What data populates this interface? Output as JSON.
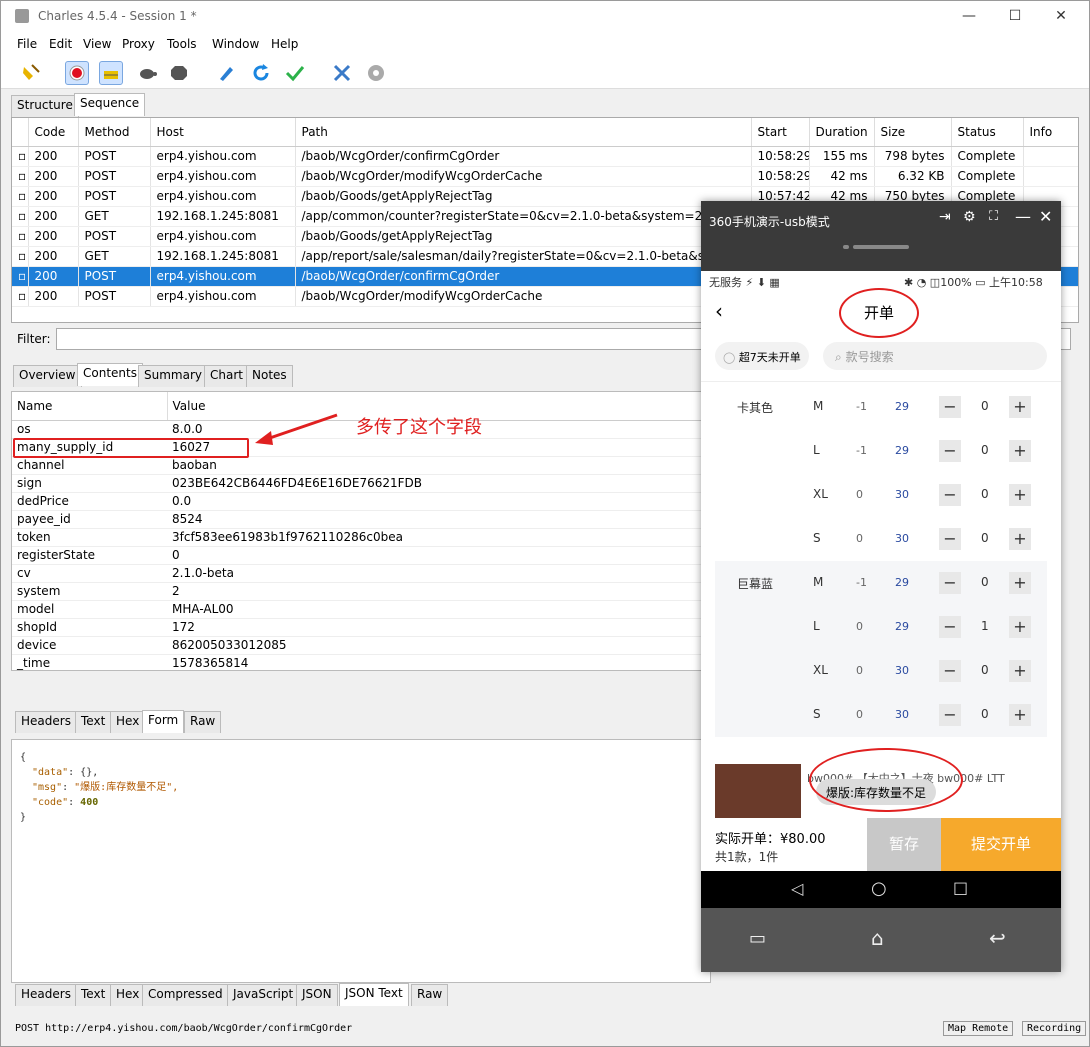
{
  "window": {
    "title": "Charles 4.5.4 - Session 1 *",
    "minimize": "—",
    "maximize": "☐",
    "close": "✕"
  },
  "menu": [
    "File",
    "Edit",
    "View",
    "Proxy",
    "Tools",
    "Window",
    "Help"
  ],
  "toolbar": {
    "icons": [
      "broom-icon",
      "record-icon",
      "throttle-icon",
      "turtle-icon",
      "stop-icon",
      "pen-icon",
      "refresh-icon",
      "check-icon",
      "tools-icon",
      "gear-icon"
    ]
  },
  "view_tabs": [
    "Structure",
    "Sequence"
  ],
  "seq": {
    "headers": [
      "Code",
      "Method",
      "Host",
      "Path",
      "Start",
      "Duration",
      "Size",
      "Status",
      "Info"
    ],
    "rows": [
      [
        "200",
        "POST",
        "erp4.yishou.com",
        "/baob/WcgOrder/confirmCgOrder",
        "10:58:29",
        "155 ms",
        "798 bytes",
        "Complete"
      ],
      [
        "200",
        "POST",
        "erp4.yishou.com",
        "/baob/WcgOrder/modifyWcgOrderCache",
        "10:58:29",
        "42 ms",
        "6.32 KB",
        "Complete"
      ],
      [
        "200",
        "POST",
        "erp4.yishou.com",
        "/baob/Goods/getApplyRejectTag",
        "10:57:42",
        "42 ms",
        "750 bytes",
        "Complete"
      ],
      [
        "200",
        "GET",
        "192.168.1.245:8081",
        "/app/common/counter?registerState=0&cv=2.1.0-beta&system=2&os",
        "",
        "",
        "",
        ""
      ],
      [
        "200",
        "POST",
        "erp4.yishou.com",
        "/baob/Goods/getApplyRejectTag",
        "",
        "",
        "",
        ""
      ],
      [
        "200",
        "GET",
        "192.168.1.245:8081",
        "/app/report/sale/salesman/daily?registerState=0&cv=2.1.0-beta&sys",
        "",
        "",
        "",
        ""
      ],
      [
        "200",
        "POST",
        "erp4.yishou.com",
        "/baob/WcgOrder/confirmCgOrder",
        "",
        "",
        "",
        ""
      ],
      [
        "200",
        "POST",
        "erp4.yishou.com",
        "/baob/WcgOrder/modifyWcgOrderCache",
        "",
        "",
        "",
        ""
      ]
    ]
  },
  "filter_label": "Filter:",
  "detail_tabs": [
    "Overview",
    "Contents",
    "Summary",
    "Chart",
    "Notes"
  ],
  "form": {
    "headers": [
      "Name",
      "Value"
    ],
    "rows": [
      [
        "os",
        "8.0.0"
      ],
      [
        "many_supply_id",
        "16027"
      ],
      [
        "channel",
        "baoban"
      ],
      [
        "sign",
        "023BE642CB6446FD4E6E16DE76621FDB"
      ],
      [
        "dedPrice",
        "0.0"
      ],
      [
        "payee_id",
        "8524"
      ],
      [
        "token",
        "3fcf583ee61983b1f9762110286c0bea"
      ],
      [
        "registerState",
        "0"
      ],
      [
        "cv",
        "2.1.0-beta"
      ],
      [
        "system",
        "2"
      ],
      [
        "model",
        "MHA-AL00"
      ],
      [
        "shopId",
        "172"
      ],
      [
        "device",
        "862005033012085"
      ],
      [
        "_time",
        "1578365814"
      ]
    ]
  },
  "annotation": "多传了这个字段",
  "req_tabs": [
    "Headers",
    "Text",
    "Hex",
    "Form",
    "Raw"
  ],
  "json_lines": {
    "open": "{",
    "data_key": "\"data\"",
    "data_val": "{},",
    "msg_key": "\"msg\"",
    "msg_val": "\"爆版:库存数量不足\",",
    "code_key": "\"code\"",
    "code_val": "400",
    "close": "}"
  },
  "resp_tabs": [
    "Headers",
    "Text",
    "Hex",
    "Compressed",
    "JavaScript",
    "JSON",
    "JSON Text",
    "Raw"
  ],
  "status": {
    "url": "POST http://erp4.yishou.com/baob/WcgOrder/confirmCgOrder",
    "map_remote": "Map Remote",
    "recording": "Recording"
  },
  "phone": {
    "window_title": "360手机演示-usb模式",
    "status_left": "无服务 ⚡ ⬇ ▦",
    "status_right": "✱ ◔ ◫100% ▭ 上午10:58",
    "page_title": "开单",
    "filter_chip": "超7天未开单",
    "search_placeholder": "款号搜索",
    "colors": [
      {
        "name": "卡其色",
        "sizes": [
          [
            "M",
            "-1",
            "29",
            "0"
          ],
          [
            "L",
            "-1",
            "29",
            "0"
          ],
          [
            "XL",
            "0",
            "30",
            "0"
          ],
          [
            "S",
            "0",
            "30",
            "0"
          ]
        ]
      },
      {
        "name": "巨幕蓝",
        "sizes": [
          [
            "M",
            "-1",
            "29",
            "0"
          ],
          [
            "L",
            "0",
            "29",
            "1"
          ],
          [
            "XL",
            "0",
            "30",
            "0"
          ],
          [
            "S",
            "0",
            "30",
            "0"
          ]
        ]
      }
    ],
    "product_text": "bw000# 【大中之】士夜 bw000# LTT",
    "toast": "爆版:库存数量不足",
    "total_label": "实际开单：¥80.00",
    "count_label": "共1款，1件",
    "save_btn": "暂存",
    "submit_btn": "提交开单"
  }
}
